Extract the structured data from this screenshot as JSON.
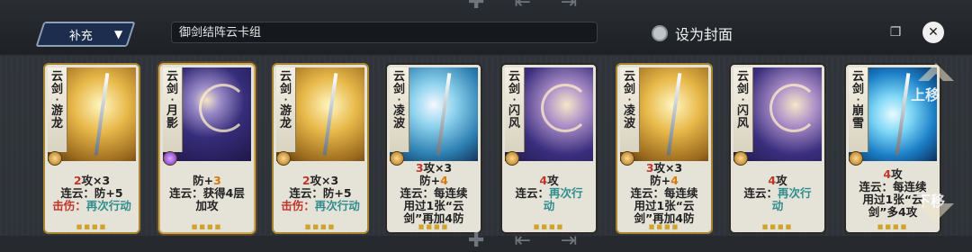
{
  "toolbar": {
    "category_label": "补充",
    "deck_name": "御剑结阵云卡组",
    "set_cover_label": "设为封面"
  },
  "cards": [
    {
      "name": [
        "云",
        "剑",
        "·",
        "游",
        "龙"
      ],
      "theme": "gold",
      "lines": [
        [
          "2",
          "攻×3"
        ],
        [
          "连云：防+5"
        ],
        [
          "击伤：",
          "再次行动"
        ]
      ]
    },
    {
      "name": [
        "云",
        "剑",
        "·",
        "月",
        "影"
      ],
      "theme": "night",
      "lines": [
        [
          "防+",
          "3"
        ],
        [
          "连云：获得4层"
        ],
        [
          "加攻"
        ]
      ]
    },
    {
      "name": [
        "云",
        "剑",
        "·",
        "游",
        "龙"
      ],
      "theme": "gold",
      "lines": [
        [
          "2",
          "攻×3"
        ],
        [
          "连云：防+5"
        ],
        [
          "击伤：",
          "再次行动"
        ]
      ]
    },
    {
      "name": [
        "云",
        "剑",
        "·",
        "凌",
        "波"
      ],
      "theme": "sky",
      "lines": [
        [
          "3",
          "攻×3"
        ],
        [
          "防+",
          "4"
        ],
        [
          "连云：每连续"
        ],
        [
          "用过1张“云"
        ],
        [
          "剑”再加4防"
        ]
      ]
    },
    {
      "name": [
        "云",
        "剑",
        "·",
        "闪",
        "风"
      ],
      "theme": "storm",
      "lines": [
        [
          "4",
          "攻"
        ],
        [
          "连云：",
          "再次行"
        ],
        [
          "动"
        ]
      ]
    },
    {
      "name": [
        "云",
        "剑",
        "·",
        "凌",
        "波"
      ],
      "theme": "gold",
      "lines": [
        [
          "3",
          "攻×3"
        ],
        [
          "防+",
          "4"
        ],
        [
          "连云：每连续"
        ],
        [
          "用过1张“云"
        ],
        [
          "剑”再加4防"
        ]
      ]
    },
    {
      "name": [
        "云",
        "剑",
        "·",
        "闪",
        "风"
      ],
      "theme": "storm",
      "lines": [
        [
          "4",
          "攻"
        ],
        [
          "连云：",
          "再次行"
        ],
        [
          "动"
        ]
      ]
    },
    {
      "name": [
        "云",
        "剑",
        "·",
        "崩",
        "雪"
      ],
      "theme": "ice",
      "lines": [
        [
          "4",
          "攻"
        ],
        [
          "连云：每连续"
        ],
        [
          "用过1张“云"
        ],
        [
          "剑”多4攻"
        ]
      ]
    }
  ],
  "overlay": {
    "move_up_label": "上移",
    "move_down_label": "下移"
  },
  "icons": [
    "chevron-down-icon",
    "copy-icon",
    "close-icon",
    "plus-icon",
    "export-icon",
    "arrow-up-icon",
    "arrow-down-icon"
  ]
}
